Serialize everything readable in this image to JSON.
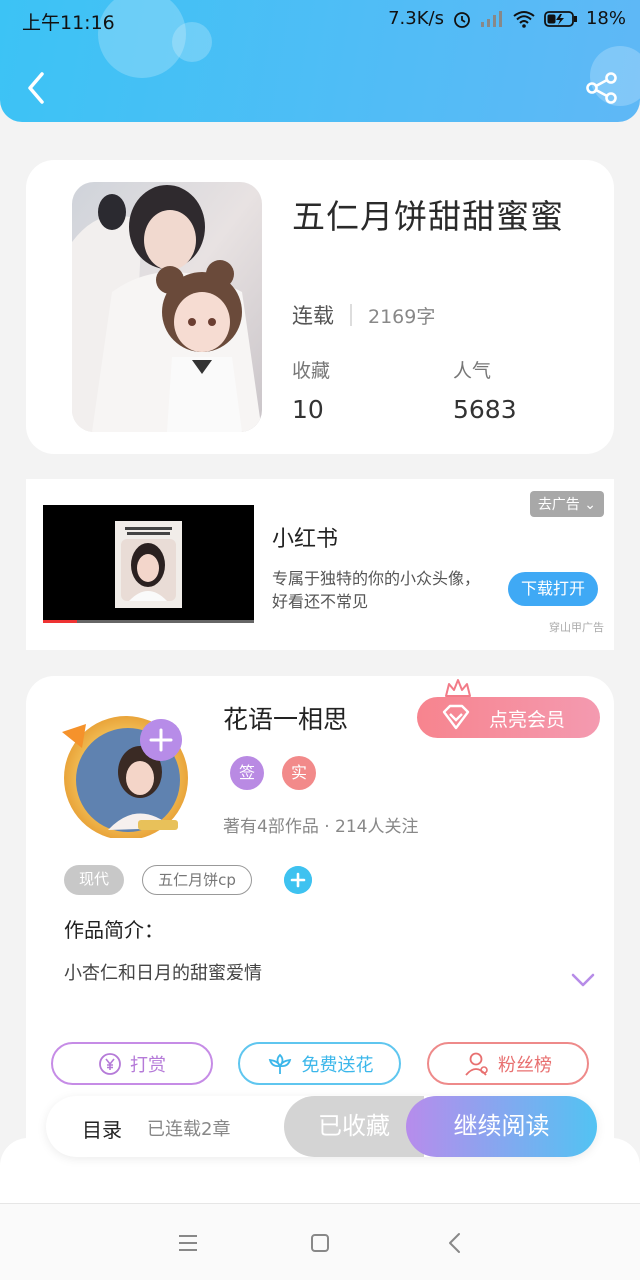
{
  "status_bar": {
    "time": "上午11:16",
    "network_speed": "7.3K/s",
    "battery": "18%"
  },
  "header": {
    "back_icon": "chevron-left-icon",
    "share_icon": "share-icon",
    "background_color": "#3cc3f5"
  },
  "book": {
    "title": "五仁月饼甜甜蜜蜜",
    "status": "连载",
    "word_count": "2169字",
    "favorites_label": "收藏",
    "favorites_value": "10",
    "popularity_label": "人气",
    "popularity_value": "5683"
  },
  "ad": {
    "remove_label": "去广告",
    "title": "小红书",
    "description": "专属于独特的你的小众头像，好看还不常见",
    "download_label": "下载打开",
    "source": "穿山甲广告"
  },
  "author": {
    "name": "花语一相思",
    "vip_label": "点亮会员",
    "badge_sign": "签",
    "badge_real": "实",
    "meta": "著有4部作品 · 214人关注",
    "tags": [
      "现代",
      "五仁月饼cp"
    ],
    "intro_label": "作品简介：",
    "intro_text": "小杏仁和日月的甜蜜爱情"
  },
  "actions": {
    "reward": "打赏",
    "free_flower": "免费送花",
    "fans_rank": "粉丝榜"
  },
  "bottom_bar": {
    "toc_label": "目录",
    "toc_count": "已连载2章",
    "collected_label": "已收藏",
    "continue_label": "继续阅读"
  },
  "colors": {
    "accent_blue": "#3ec2f0",
    "accent_purple": "#b78ce8",
    "vip_pink": "#f7848e"
  }
}
